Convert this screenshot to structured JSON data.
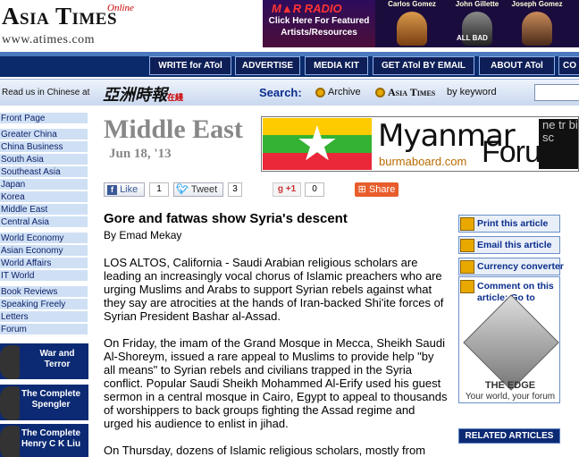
{
  "masthead": {
    "logo": "Asia Times",
    "logo_suffix": "Online",
    "url": "www.atimes.com"
  },
  "banner_ad": {
    "brand": "M▲R RADIO",
    "cta": "Click Here For Featured Artists/Resources",
    "artists": [
      "Carlos Gomez",
      "John Gillette",
      "Joseph Gomez"
    ],
    "tag": "ALL BAD"
  },
  "nav": {
    "items": [
      "WRITE for ATol",
      "ADVERTISE",
      "MEDIA KIT",
      "GET ATol BY EMAIL",
      "ABOUT ATol",
      "CO"
    ]
  },
  "search": {
    "read_chinese": "Read us in Chinese at",
    "chinese_logo": "亞洲時報",
    "chinese_suffix": "在綫",
    "label": "Search:",
    "opt_archive": "Archive",
    "opt_atimes": "Asia Times",
    "opt_keyword": "by keyword",
    "input_value": ""
  },
  "sidebar": {
    "items": [
      "Front Page",
      "Greater China",
      "China Business",
      "South Asia",
      "Southeast Asia",
      "Japan",
      "Korea",
      "Middle East",
      "Central Asia",
      "World Economy",
      "Asian Economy",
      "World Affairs",
      "IT World",
      "Book Reviews",
      "Speaking Freely",
      "Letters",
      "Forum"
    ],
    "promos": [
      "War and Terror",
      "The Complete Spengler",
      "The Complete Henry C K Liu"
    ]
  },
  "section": {
    "title": "Middle East",
    "date": "Jun 18, '13"
  },
  "myanmar_ad": {
    "title_left": "Myanmar",
    "title_right": "Forum",
    "url": "burmaboard.com",
    "side_text": "ne tr bi sc"
  },
  "social": {
    "like_label": "Like",
    "like_count": "1",
    "tweet_label": "Tweet",
    "tweet_count": "3",
    "gplus_label": "+1",
    "gplus_count": "0",
    "share_label": "Share"
  },
  "article": {
    "headline": "Gore and fatwas show Syria's descent",
    "byline": "By Emad Mekay",
    "paragraphs": [
      "LOS ALTOS, California - Saudi Arabian religious scholars are leading an increasingly vocal chorus of Islamic preachers who are urging Muslims and Arabs to support Syrian rebels against what they say are atrocities at the hands of Iran-backed Shi'ite forces of Syrian President Bashar al-Assad.",
      "On Friday, the imam of the Grand Mosque in Mecca, Sheikh Saudi Al-Shoreym, issued a rare appeal to Muslims to provide help \"by all means\" to Syrian rebels and civilians trapped in the Syria conflict. Popular Saudi Sheikh Mohammed Al-Erify used his guest sermon in a central mosque in Cairo, Egypt to appeal to thousands of worshippers to back groups fighting the Assad regime and urged his audience to enlist in jihad.",
      "On Thursday, dozens of Islamic religious scholars, mostly from"
    ]
  },
  "tools": {
    "print": "Print this article",
    "email": "Email this article",
    "currency": "Currency converter",
    "comment": "Comment on this article: Go to",
    "edge_name": "THE EDGE",
    "edge_sub": "Your world, your forum",
    "related": "RELATED ARTICLES"
  }
}
